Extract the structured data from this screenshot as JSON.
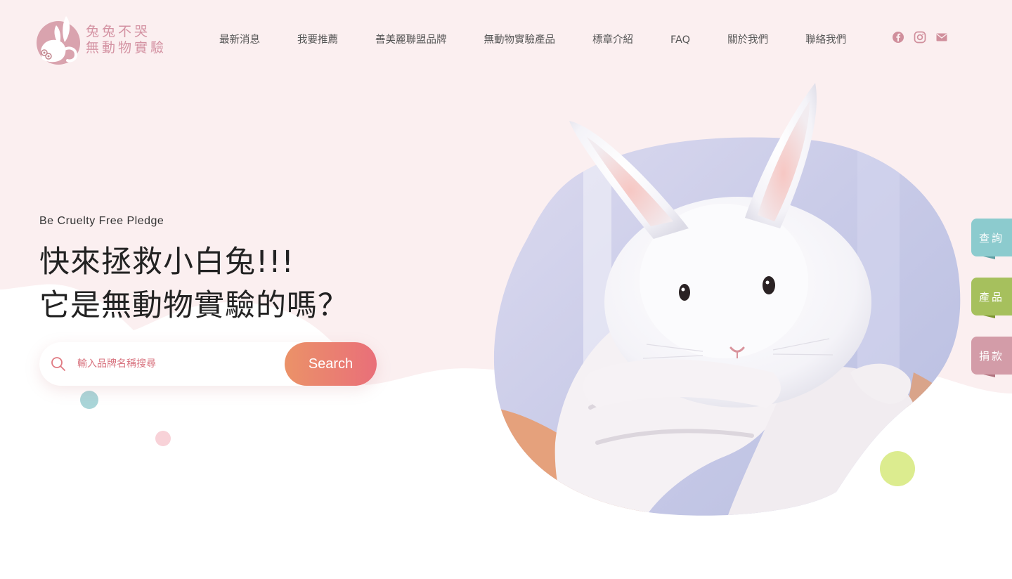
{
  "brand": {
    "line1": "兔兔不哭",
    "line2": "無動物實驗",
    "accent": "#d493a3"
  },
  "nav": {
    "items": [
      {
        "label": "最新消息"
      },
      {
        "label": "我要推薦"
      },
      {
        "label": "善美麗聯盟品牌"
      },
      {
        "label": "無動物實驗產品"
      },
      {
        "label": "標章介紹"
      },
      {
        "label": "FAQ"
      },
      {
        "label": "關於我們"
      },
      {
        "label": "聯絡我們"
      }
    ]
  },
  "social": {
    "icons": [
      "facebook-icon",
      "instagram-icon",
      "mail-icon"
    ],
    "color": "#d08f9c"
  },
  "hero": {
    "subtitle": "Be Cruelty Free Pledge",
    "title_line1": "快來拯救小白兔!!!",
    "title_line2": "它是無動物實驗的嗎？",
    "background": "#fbeff0"
  },
  "search": {
    "placeholder": "輸入品牌名稱搜尋",
    "button_label": "Search",
    "button_gradient": [
      "#eb9268",
      "#e96f79"
    ]
  },
  "side_tabs": [
    {
      "label": "查詢",
      "color": "#8ccbce"
    },
    {
      "label": "產品",
      "color": "#a6c05d"
    },
    {
      "label": "捐款",
      "color": "#d39ca8"
    }
  ]
}
